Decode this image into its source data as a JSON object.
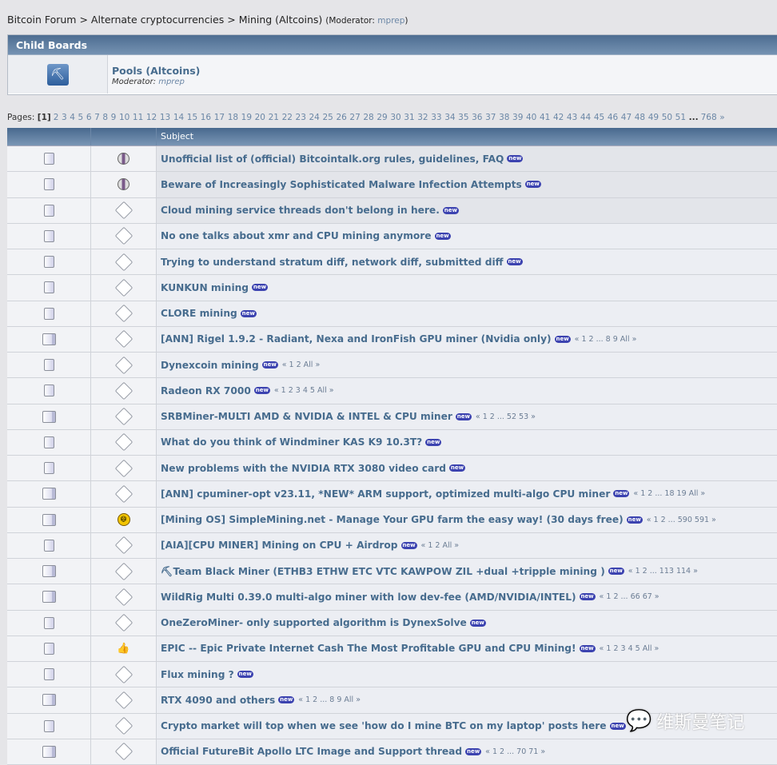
{
  "breadcrumb": {
    "items": [
      "Bitcoin Forum",
      "Alternate cryptocurrencies",
      "Mining (Altcoins)"
    ],
    "sep": ">",
    "moderator_label": "(Moderator:",
    "moderator": "mprep",
    "close": ")"
  },
  "child_boards": {
    "title": "Child Boards",
    "board": "Pools (Altcoins)",
    "moderator_label": "Moderator:",
    "moderator": "mprep"
  },
  "pagination": {
    "label": "Pages:",
    "current": "[1]",
    "pages": [
      "2",
      "3",
      "4",
      "5",
      "6",
      "7",
      "8",
      "9",
      "10",
      "11",
      "12",
      "13",
      "14",
      "15",
      "16",
      "17",
      "18",
      "19",
      "20",
      "21",
      "22",
      "23",
      "24",
      "25",
      "26",
      "27",
      "28",
      "29",
      "30",
      "31",
      "32",
      "33",
      "34",
      "35",
      "36",
      "37",
      "38",
      "39",
      "40",
      "41",
      "42",
      "43",
      "44",
      "45",
      "46",
      "47",
      "48",
      "49",
      "50",
      "51"
    ],
    "ellipsis": "...",
    "last": "768",
    "next": "»"
  },
  "table": {
    "subject_header": "Subject",
    "new_badge": "new",
    "rows": [
      {
        "title": "Unofficial list of (official) Bitcointalk.org rules, guidelines, FAQ",
        "icon": "note",
        "hot": false,
        "sticky": true,
        "pages": ""
      },
      {
        "title": "Beware of Increasingly Sophisticated Malware Infection Attempts",
        "icon": "note",
        "hot": false,
        "sticky": true,
        "pages": ""
      },
      {
        "title": "Cloud mining service threads don't belong in here.",
        "icon": "xx",
        "hot": false,
        "sticky": true,
        "pages": ""
      },
      {
        "title": "No one talks about xmr and CPU mining anymore",
        "icon": "xx",
        "hot": false,
        "pages": ""
      },
      {
        "title": "Trying to understand stratum diff, network diff, submitted diff",
        "icon": "xx",
        "hot": false,
        "pages": ""
      },
      {
        "title": "KUNKUN mining",
        "icon": "xx",
        "hot": false,
        "pages": ""
      },
      {
        "title": "CLORE mining",
        "icon": "xx",
        "hot": false,
        "pages": ""
      },
      {
        "title": "[ANN] Rigel 1.9.2 - Radiant, Nexa and IronFish GPU miner (Nvidia only)",
        "icon": "xx",
        "hot": true,
        "pages": "« 1 2 ... 8 9  All »"
      },
      {
        "title": "Dynexcoin mining",
        "icon": "xx",
        "hot": false,
        "pages": "« 1 2  All »"
      },
      {
        "title": "Radeon RX 7000",
        "icon": "xx",
        "hot": false,
        "pages": "« 1 2 3 4 5  All »"
      },
      {
        "title": "SRBMiner-MULTI AMD & NVIDIA & INTEL & CPU miner",
        "icon": "xx",
        "hot": true,
        "pages": "« 1 2 ... 52 53 »"
      },
      {
        "title": "What do you think of Windminer KAS K9 10.3T?",
        "icon": "xx",
        "hot": false,
        "pages": ""
      },
      {
        "title": "New problems with the NVIDIA RTX 3080 video card",
        "icon": "xx",
        "hot": false,
        "pages": ""
      },
      {
        "title": "[ANN] cpuminer-opt v23.11, *NEW* ARM support, optimized multi-algo CPU miner",
        "icon": "xx",
        "hot": true,
        "pages": "« 1 2 ... 18 19  All »"
      },
      {
        "title": "[Mining OS] SimpleMining.net - Manage Your GPU farm the easy way! (30 days free)",
        "icon": "smiley",
        "hot": true,
        "pages": "« 1 2 ... 590 591 »"
      },
      {
        "title": "[AIA][CPU MINER] Mining on CPU + Airdrop",
        "icon": "xx",
        "hot": false,
        "pages": "« 1 2  All »"
      },
      {
        "title": "⛏Team Black Miner (ETHB3 ETHW ETC VTC KAWPOW ZIL +dual +tripple mining )",
        "icon": "xx",
        "hot": true,
        "pages": "« 1 2 ... 113 114 »"
      },
      {
        "title": "WildRig Multi 0.39.0 multi-algo miner with low dev-fee (AMD/NVIDIA/INTEL)",
        "icon": "xx",
        "hot": true,
        "pages": "« 1 2 ... 66 67 »"
      },
      {
        "title": "OneZeroMiner- only supported algorithm is DynexSolve",
        "icon": "xx",
        "hot": false,
        "pages": ""
      },
      {
        "title": "EPIC -- Epic Private Internet Cash The Most Profitable GPU and CPU Mining!",
        "icon": "thumbup",
        "hot": false,
        "pages": "« 1 2 3 4 5  All »"
      },
      {
        "title": "Flux mining ?",
        "icon": "xx",
        "hot": false,
        "pages": ""
      },
      {
        "title": "RTX 4090 and others",
        "icon": "xx",
        "hot": true,
        "pages": "« 1 2 ... 8 9  All »"
      },
      {
        "title": "Crypto market will top when we see 'how do I mine BTC on my laptop' posts here",
        "icon": "xx",
        "hot": false,
        "pages": ""
      },
      {
        "title": "Official FutureBit Apollo LTC Image and Support thread",
        "icon": "xx",
        "hot": true,
        "pages": "« 1 2 ... 70 71 »"
      }
    ]
  },
  "watermark": "维斯曼笔记"
}
